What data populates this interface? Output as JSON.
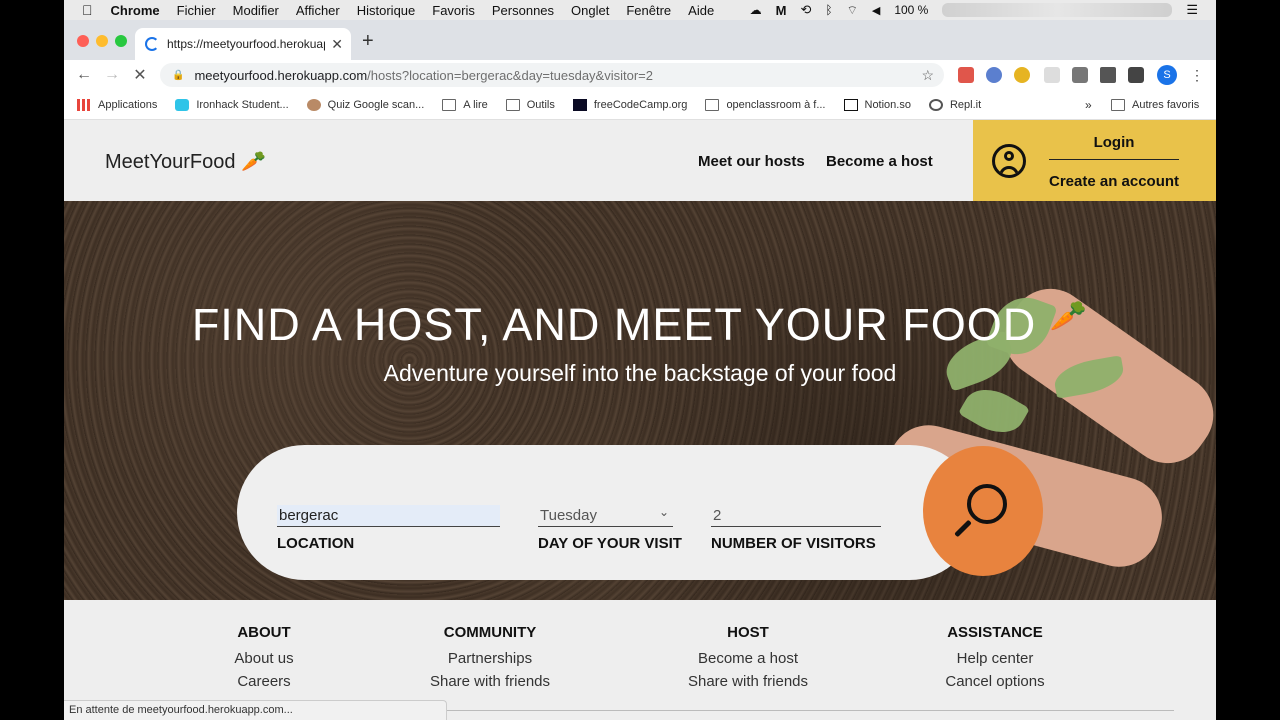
{
  "menubar": {
    "items": [
      "Chrome",
      "Fichier",
      "Modifier",
      "Afficher",
      "Historique",
      "Favoris",
      "Personnes",
      "Onglet",
      "Fenêtre",
      "Aide"
    ],
    "battery": "100 %"
  },
  "browser": {
    "tab_title": "https://meetyourfood.herokuapp",
    "url_host": "meetyourfood.herokuapp.com",
    "url_path": "/hosts?location=bergerac&day=tuesday&visitor=2",
    "profile_initial": "S",
    "bookmarks": [
      "Applications",
      "Ironhack Student...",
      "Quiz Google scan...",
      "A lire",
      "Outils",
      "freeCodeCamp.org",
      "openclassroom à f...",
      "Notion.so",
      "Repl.it"
    ],
    "other_bookmarks": "Autres favoris",
    "status_text": "En attente de meetyourfood.herokuapp.com..."
  },
  "site": {
    "logo": "MeetYourFood",
    "nav": {
      "meet_hosts": "Meet our hosts",
      "become_host": "Become a host",
      "login": "Login",
      "create_account": "Create an account"
    },
    "hero": {
      "title": "FIND A HOST, AND MEET YOUR FOOD",
      "subtitle": "Adventure yourself into the backstage of your food"
    },
    "search": {
      "location_value": "bergerac",
      "location_label": "LOCATION",
      "day_value": "Tuesday",
      "day_label": "DAY OF YOUR VISIT",
      "visitors_value": "2",
      "visitors_label": "NUMBER OF VISITORS"
    },
    "footer": {
      "about": {
        "title": "ABOUT",
        "links": [
          "About us",
          "Careers"
        ]
      },
      "community": {
        "title": "COMMUNITY",
        "links": [
          "Partnerships",
          "Share with friends"
        ]
      },
      "host": {
        "title": "HOST",
        "links": [
          "Become a host",
          "Share with friends"
        ]
      },
      "assistance": {
        "title": "ASSISTANCE",
        "links": [
          "Help center",
          "Cancel options"
        ]
      }
    }
  },
  "colors": {
    "account_bg": "#e9c24a",
    "search_button": "#e8833e"
  }
}
